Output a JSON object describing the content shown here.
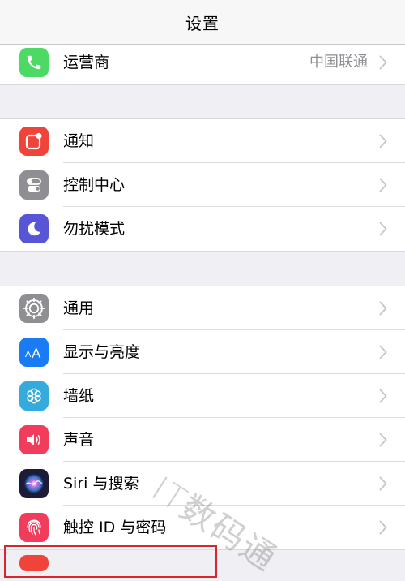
{
  "nav": {
    "title": "设置"
  },
  "groups": [
    {
      "items": [
        {
          "label": "运营商",
          "value": "中国联通",
          "icon": "phone-icon",
          "color": "#4cd964"
        }
      ]
    },
    {
      "items": [
        {
          "label": "通知",
          "icon": "notifications-icon",
          "color": "#f0433a"
        },
        {
          "label": "控制中心",
          "icon": "control-center-icon",
          "color": "#8e8e93"
        },
        {
          "label": "勿扰模式",
          "icon": "moon-icon",
          "color": "#5856d6"
        }
      ]
    },
    {
      "items": [
        {
          "label": "通用",
          "icon": "gear-icon",
          "color": "#8e8e93"
        },
        {
          "label": "显示与亮度",
          "icon": "display-brightness-icon",
          "color": "#1a7cf5"
        },
        {
          "label": "墙纸",
          "icon": "wallpaper-icon",
          "color": "#35aadc"
        },
        {
          "label": "声音",
          "icon": "speaker-icon",
          "color": "#f23c5c"
        },
        {
          "label": "Siri 与搜索",
          "icon": "siri-icon",
          "color": "#1c1c3a"
        },
        {
          "label": "触控 ID 与密码",
          "icon": "fingerprint-icon",
          "color": "#f23c5c"
        }
      ]
    }
  ],
  "watermark": "IT数码通"
}
